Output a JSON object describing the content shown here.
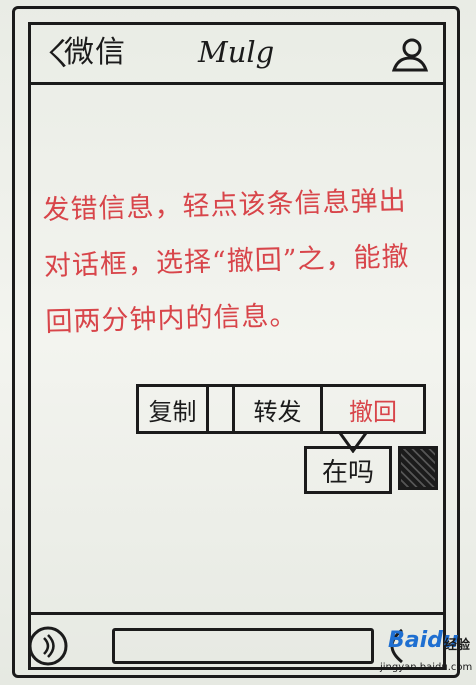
{
  "header": {
    "back_glyph": "ㄑ",
    "title": "微信",
    "contact_name": "Mulg"
  },
  "message": {
    "text": "发错信息，轻点该条信息弹出对话框，选择“撤回”之，能撤回两分钟内的信息。"
  },
  "context_menu": {
    "copy_label": "复制",
    "forward_label": "转发",
    "recall_label": "撤回"
  },
  "selected_message": {
    "text": "在吗"
  },
  "input_bar": {
    "placeholder": ""
  },
  "watermark": {
    "brand": "Baidu",
    "side": "经验",
    "url": "jingyan.baidu.com"
  },
  "colors": {
    "ink": "#1b1b1b",
    "red_ink": "#d8454a",
    "watermark_blue": "#1f6fd1"
  }
}
